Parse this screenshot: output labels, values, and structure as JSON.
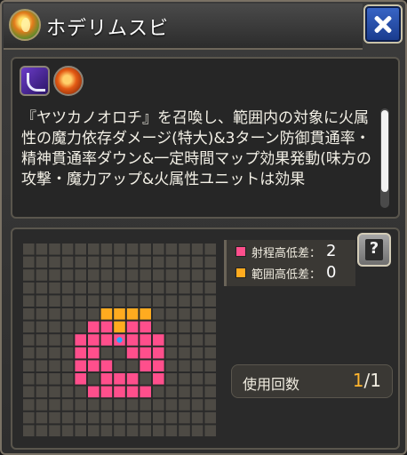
{
  "title": "ホデリムスビ",
  "title_icon": "fire-orb-icon",
  "close_icon": "close-icon",
  "skill_icons": [
    "tornado-skill-icon",
    "fire-element-icon"
  ],
  "description": "『ヤツカノオロチ』を召喚し、範囲内の対象に火属性の魔力依存ダメージ(特大)&3ターン防御貫通率・精神貫通率ダウン&一定時間マップ効果発動(味方の攻撃・魔力アップ&火属性ユニットは効果",
  "description_scroll_fraction": 0.0,
  "range": {
    "legend": [
      {
        "label": "射程高低差：",
        "value": "2",
        "color": "#ff4f8c"
      },
      {
        "label": "範囲高低差：",
        "value": "0",
        "color": "#ffab1f"
      }
    ],
    "help_label": "?",
    "usage": {
      "label": "使用回数",
      "current": "1",
      "sep": "/",
      "max": "1"
    },
    "grid": {
      "size": 15,
      "caster_cell": [
        7,
        7
      ],
      "range_cells": [
        [
          5,
          6
        ],
        [
          6,
          6
        ],
        [
          7,
          6
        ],
        [
          8,
          6
        ],
        [
          9,
          6
        ],
        [
          4,
          7
        ],
        [
          5,
          7
        ],
        [
          6,
          7
        ],
        [
          7,
          7
        ],
        [
          8,
          7
        ],
        [
          9,
          7
        ],
        [
          10,
          7
        ],
        [
          4,
          8
        ],
        [
          5,
          8
        ],
        [
          8,
          8
        ],
        [
          9,
          8
        ],
        [
          10,
          8
        ],
        [
          4,
          9
        ],
        [
          5,
          9
        ],
        [
          6,
          9
        ],
        [
          9,
          9
        ],
        [
          10,
          9
        ],
        [
          4,
          10
        ],
        [
          6,
          10
        ],
        [
          7,
          10
        ],
        [
          8,
          10
        ],
        [
          10,
          10
        ],
        [
          5,
          11
        ],
        [
          6,
          11
        ],
        [
          7,
          11
        ],
        [
          8,
          11
        ],
        [
          9,
          11
        ]
      ],
      "area_cells": [
        [
          6,
          5
        ],
        [
          7,
          5
        ],
        [
          8,
          5
        ],
        [
          9,
          5
        ],
        [
          7,
          6
        ]
      ],
      "colors": {
        "empty": "#4d4a44",
        "range": "#ff4f8c",
        "area": "#ffab1f",
        "caster": "#2aa9ff",
        "grid_bg": "#2a2a2a"
      }
    }
  }
}
